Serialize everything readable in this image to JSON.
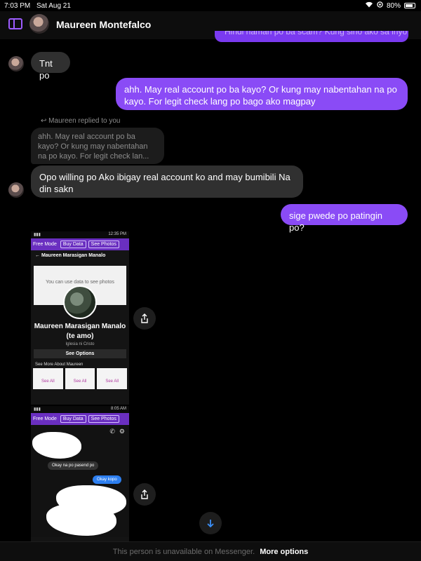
{
  "status_bar": {
    "time": "7:03 PM",
    "date": "Sat Aug 21",
    "battery": "80%"
  },
  "header": {
    "contact_name": "Maureen Montefalco",
    "peek_text": "Hindi naman po ba scam? Kung sino ako sa inyo"
  },
  "messages": {
    "m1": "Tnt po",
    "m2": "ahh. May real account po ba kayo? Or kung may nabentahan na po kayo. For legit check lang po bago ako magpay",
    "reply_label": "Maureen replied to you",
    "quoted": "ahh. May real account po ba kayo? Or kung may nabentahan na po kayo. For legit check lan...",
    "m3": "Opo willing po Ako ibigay real account ko and may bumibili Na din sakn",
    "m4": "sige pwede po patingin po?"
  },
  "screenshot1": {
    "status_time": "12:35 PM",
    "free_mode": "Free Mode",
    "buy_data": "Buy Data",
    "see_photos": "See Photos",
    "nav_title": "Maureen Marasigan Manalo",
    "data_note": "You can use data to see photos",
    "name_line1": "Maureen Marasigan Manalo",
    "name_line2": "(te amo)",
    "church": "Iglesia ni Cristo",
    "see_options": "See Options",
    "see_more": "See More About Maureen",
    "tiles": [
      "See All",
      "See All",
      "See All"
    ]
  },
  "screenshot2": {
    "status_time": "8:05 AM",
    "free_mode": "Free Mode",
    "buy_data": "Buy Data",
    "see_photos": "See Photos",
    "incoming": "Okay na po pasend po",
    "outgoing": "Okay kopo"
  },
  "footer": {
    "note": "This person is unavailable on Messenger.",
    "more": "More options"
  }
}
